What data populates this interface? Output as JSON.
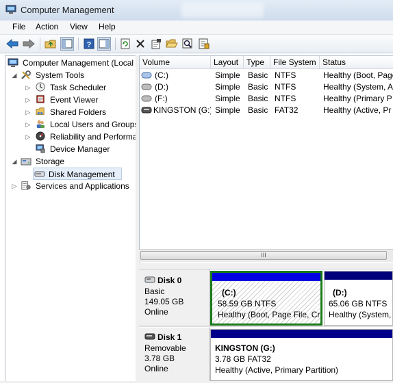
{
  "window": {
    "title": "Computer Management"
  },
  "menu": {
    "file": "File",
    "action": "Action",
    "view": "View",
    "help": "Help"
  },
  "toolbar": {
    "icons": [
      "back-arrow-icon",
      "forward-arrow-icon",
      "up-folder-icon",
      "show-hide-console-tree-icon",
      "help-icon",
      "properties-panel-icon",
      "refresh-icon",
      "delete-icon",
      "properties-icon",
      "open-icon",
      "search-icon",
      "export-list-icon"
    ]
  },
  "tree": {
    "root": "Computer Management (Local",
    "system_tools": "System Tools",
    "task_scheduler": "Task Scheduler",
    "event_viewer": "Event Viewer",
    "shared_folders": "Shared Folders",
    "local_users": "Local Users and Groups",
    "reliability": "Reliability and Performa",
    "device_manager": "Device Manager",
    "storage": "Storage",
    "disk_management": "Disk Management",
    "services": "Services and Applications"
  },
  "volumes": {
    "headers": {
      "volume": "Volume",
      "layout": "Layout",
      "type": "Type",
      "fs": "File System",
      "status": "Status"
    },
    "rows": [
      {
        "volume": "(C:)",
        "layout": "Simple",
        "type": "Basic",
        "fs": "NTFS",
        "status": "Healthy (Boot, Page"
      },
      {
        "volume": "(D:)",
        "layout": "Simple",
        "type": "Basic",
        "fs": "NTFS",
        "status": "Healthy (System, A"
      },
      {
        "volume": "(F:)",
        "layout": "Simple",
        "type": "Basic",
        "fs": "NTFS",
        "status": "Healthy (Primary P"
      },
      {
        "volume": "KINGSTON (G:)",
        "layout": "Simple",
        "type": "Basic",
        "fs": "FAT32",
        "status": "Healthy (Active, Pr"
      }
    ]
  },
  "scroll": {
    "thumb": "III"
  },
  "disks": {
    "disk0": {
      "name": "Disk 0",
      "kind": "Basic",
      "size": "149.05 GB",
      "state": "Online",
      "c": {
        "label": "(C:)",
        "size": "58.59 GB NTFS",
        "status": "Healthy (Boot, Page File, Cr"
      },
      "d": {
        "label": "(D:)",
        "size": "65.06 GB NTFS",
        "status": "Healthy (System,"
      }
    },
    "disk1": {
      "name": "Disk 1",
      "kind": "Removable",
      "size": "3.78 GB",
      "state": "Online",
      "g": {
        "label": "KINGSTON  (G:)",
        "size": "3.78 GB FAT32",
        "status": "Healthy (Active, Primary Partition)"
      }
    }
  },
  "colors": {
    "primary_partition": "#0000a8",
    "selected_partition": "#1a7a1a",
    "title_bar": "#d6e2f0"
  }
}
